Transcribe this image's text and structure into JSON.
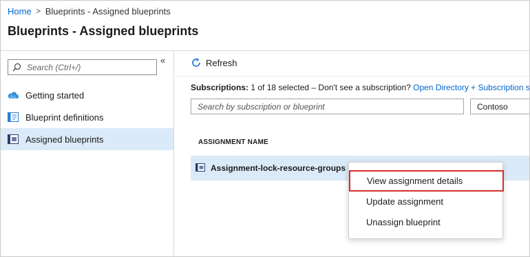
{
  "breadcrumb": {
    "home": "Home",
    "separator": ">",
    "current": "Blueprints - Assigned blueprints"
  },
  "page": {
    "title": "Blueprints - Assigned blueprints"
  },
  "sidebar": {
    "collapse_icon": "double-chevron-left-icon",
    "collapse_glyph": "«",
    "search": {
      "placeholder": "Search (Ctrl+/)",
      "value": ""
    },
    "items": [
      {
        "label": "Getting started",
        "icon": "cloud-icon"
      },
      {
        "label": "Blueprint definitions",
        "icon": "blueprint-definition-icon"
      },
      {
        "label": "Assigned blueprints",
        "icon": "assigned-blueprint-icon",
        "active": true
      }
    ]
  },
  "toolbar": {
    "refresh_label": "Refresh",
    "refresh_icon": "refresh-icon"
  },
  "subscriptions": {
    "label": "Subscriptions:",
    "text": " 1 of 18 selected – Don't see a subscription? ",
    "link": "Open Directory + Subscription se"
  },
  "filter": {
    "placeholder": "Search by subscription or blueprint",
    "value": "",
    "directory_value": "Contoso"
  },
  "table": {
    "columns": [
      "ASSIGNMENT NAME"
    ],
    "rows": [
      {
        "name": "Assignment-lock-resource-groups",
        "icon": "assignment-icon"
      }
    ]
  },
  "context_menu": {
    "items": [
      {
        "label": "View assignment details",
        "highlighted": true
      },
      {
        "label": "Update assignment"
      },
      {
        "label": "Unassign blueprint"
      }
    ],
    "highlight_color": "#d92b2b"
  },
  "colors": {
    "link": "#0066cc",
    "selection": "#dbeaf8",
    "icon_blue": "#2b7fd6"
  }
}
